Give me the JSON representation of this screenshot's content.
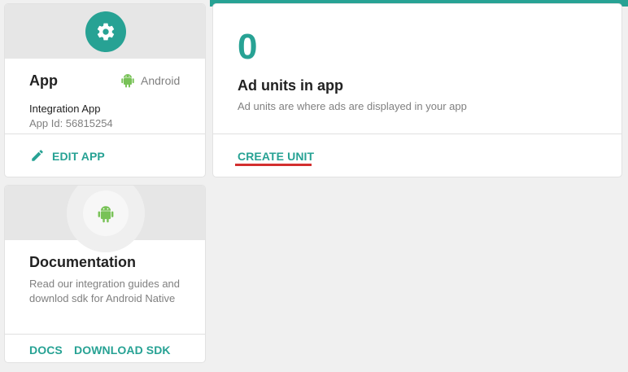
{
  "colors": {
    "accent": "#27a294",
    "android_green": "#78c257",
    "underline_red": "#d32f2f",
    "page_bg": "#f0f0f0"
  },
  "app_card": {
    "header_icon": "gear-icon",
    "title": "App",
    "platform_icon": "android-icon",
    "platform": "Android",
    "app_name": "Integration App",
    "app_id": "App Id: 56815254",
    "edit_icon": "pencil-icon",
    "edit_label": "EDIT APP"
  },
  "ad_units_card": {
    "count": "0",
    "title": "Ad units in app",
    "description": "Ad units are where ads are displayed in your app",
    "action_label": "CREATE UNIT"
  },
  "docs_card": {
    "header_icon": "android-icon",
    "title": "Documentation",
    "description": "Read our integration guides and downlod sdk for Android Native",
    "docs_label": "DOCS",
    "download_label": "DOWNLOAD SDK"
  }
}
